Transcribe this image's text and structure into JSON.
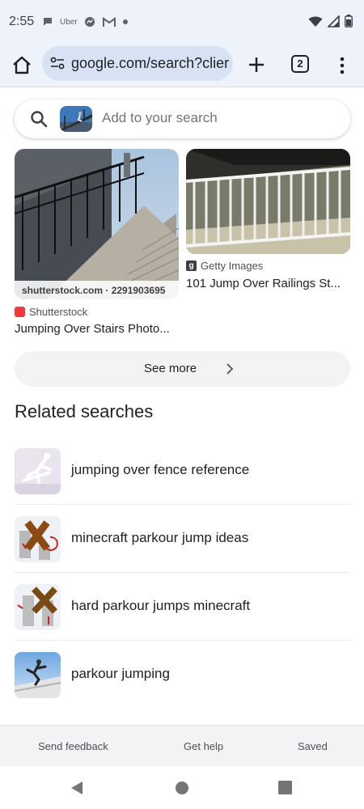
{
  "status_bar": {
    "time": "2:55",
    "uber_label": "Uber",
    "icons": [
      "chat-icon",
      "uber-icon",
      "messenger-icon",
      "gmail-icon",
      "dot-icon",
      "wifi-icon",
      "signal-icon",
      "battery-icon"
    ]
  },
  "toolbar": {
    "url": "google.com/search?clier",
    "tab_count": "2"
  },
  "search": {
    "placeholder": "Add to your search"
  },
  "results": [
    {
      "watermark": "shutterstock.com · 2291903695",
      "source": "Shutterstock",
      "title": "Jumping Over Stairs Photo..."
    },
    {
      "source": "Getty Images",
      "title": "101 Jump Over Railings St..."
    }
  ],
  "see_more_label": "See more",
  "related": {
    "heading": "Related searches",
    "items": [
      {
        "label": "jumping over fence reference"
      },
      {
        "label": "minecraft parkour jump ideas"
      },
      {
        "label": "hard parkour jumps minecraft"
      },
      {
        "label": "parkour jumping"
      }
    ]
  },
  "footer": {
    "feedback": "Send feedback",
    "help": "Get help",
    "saved": "Saved"
  },
  "colors": {
    "chrome_bg": "#eef3fb",
    "omnibox_bg": "#d7e3f4",
    "pill_bg": "#f1f3f4",
    "text": "#202124"
  }
}
